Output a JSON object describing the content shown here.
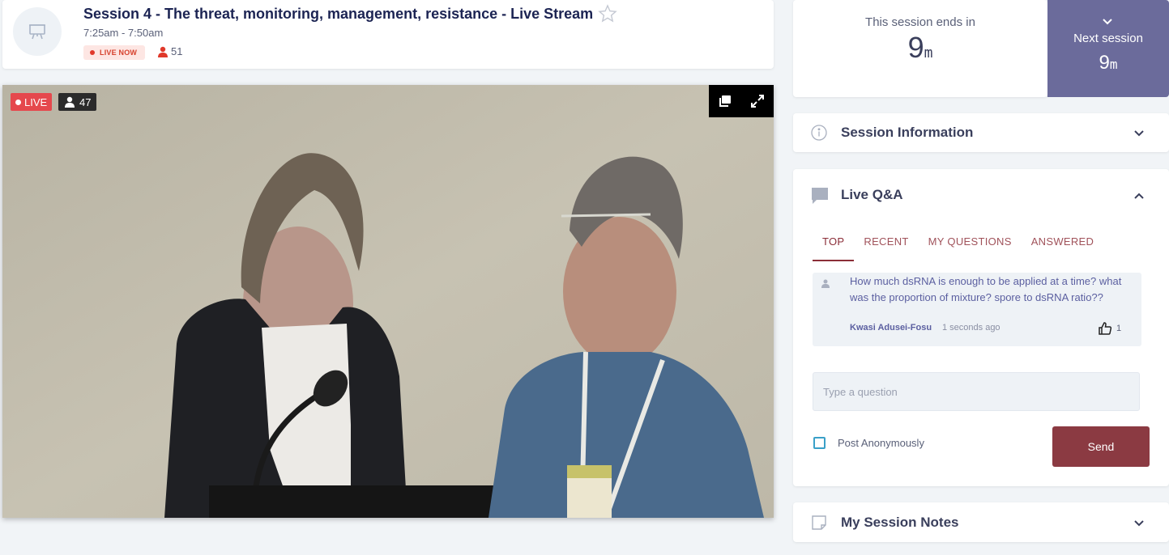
{
  "session": {
    "title": "Session 4 - The threat, monitoring, management, resistance - Live Stream",
    "time": "7:25am - 7:50am",
    "live_badge": "LIVE NOW",
    "attendee_count": "51"
  },
  "video": {
    "live_label": "LIVE",
    "viewer_count": "47"
  },
  "countdown": {
    "label": "This session ends in",
    "value": "9",
    "unit": "m"
  },
  "next_session": {
    "label": "Next session",
    "value": "9",
    "unit": "m"
  },
  "panels": {
    "session_info": "Session Information",
    "live_qa": "Live Q&A",
    "notes": "My Session Notes"
  },
  "qa": {
    "tabs": [
      "TOP",
      "RECENT",
      "MY QUESTIONS",
      "ANSWERED"
    ],
    "active_tab": "TOP",
    "questions": [
      {
        "text": "How much dsRNA is enough to be applied at a time? what was the proportion of mixture? spore to dsRNA ratio??",
        "author": "Kwasi Adusei-Fosu",
        "time": "1 seconds ago",
        "likes": "1"
      }
    ],
    "input_placeholder": "Type a question",
    "anonymous_label": "Post Anonymously",
    "send_label": "Send"
  },
  "colors": {
    "accent": "#8b3a42",
    "next_session_bg": "#6b6b9b",
    "live_red": "#e5484d"
  }
}
